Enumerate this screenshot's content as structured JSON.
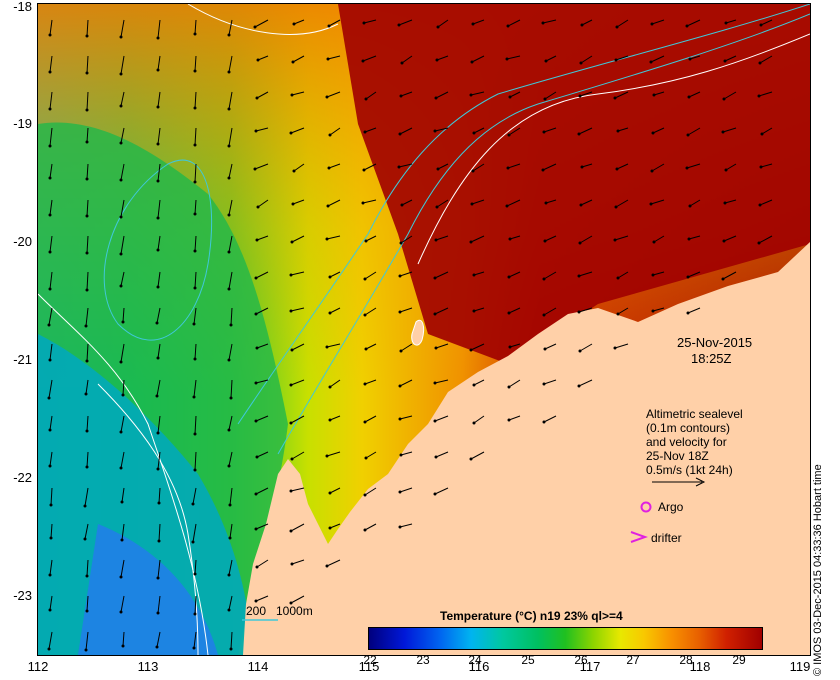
{
  "axes": {
    "y_labels": [
      "-18",
      "-19",
      "-20",
      "-21",
      "-22",
      "-23"
    ],
    "x_labels": [
      "112",
      "113",
      "114",
      "115",
      "116",
      "117",
      "118",
      "119"
    ]
  },
  "map": {
    "datetime": {
      "date": "25-Nov-2015",
      "time": "18:25Z"
    },
    "altimetry_note": [
      "Altimetric sealevel",
      "(0.1m contours)",
      "and velocity for",
      "25-Nov 18Z",
      "0.5m/s (1kt 24h)"
    ],
    "argo_label": "Argo",
    "drifter_label": "drifter",
    "bathymetry_legend": {
      "depth_1": "200",
      "depth_2": "1000m"
    },
    "colors": {
      "land": "#ffd0a8",
      "argo": "#e020e0",
      "drifter": "#e020e0",
      "bathymetry_line": "#40c8d8",
      "sealevel_contour": "#ffffff",
      "velocity_arrow": "#000000"
    }
  },
  "colorbar": {
    "title": "Temperature (°C) n19 23% ql>=4",
    "labels": [
      "22",
      "23",
      "24",
      "25",
      "26",
      "27",
      "28",
      "29"
    ],
    "range": [
      22,
      29.5
    ]
  },
  "credit": "© IMOS 03-Dec-2015 04:33:36 Hobart time"
}
